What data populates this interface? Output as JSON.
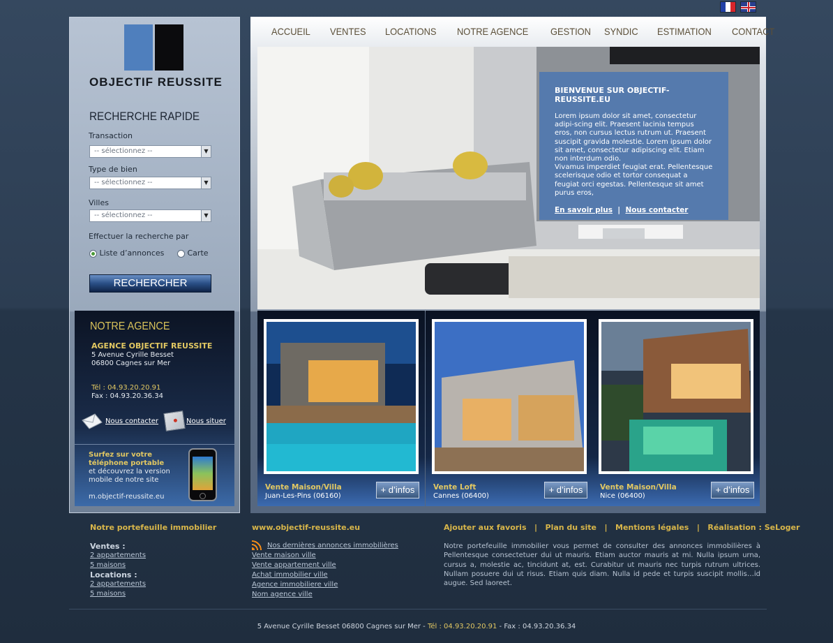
{
  "languages": [
    {
      "name": "Français",
      "icon": "flag-fr-icon"
    },
    {
      "name": "English",
      "icon": "flag-uk-icon"
    }
  ],
  "brand": {
    "name": "OBJECTIF REUSSITE",
    "colors": {
      "blue": "#4f7fbd",
      "black": "#0b0b0d"
    }
  },
  "nav": {
    "items": [
      "ACCUEIL",
      "VENTES",
      "LOCATIONS",
      "NOTRE AGENCE",
      "GESTION",
      "SYNDIC",
      "ESTIMATION",
      "CONTACT"
    ]
  },
  "search": {
    "title": "RECHERCHE RAPIDE",
    "transaction_label": "Transaction",
    "type_label": "Type de bien",
    "villes_label": "Villes",
    "select_value": "-- sélectionnez --",
    "mode_label": "Effectuer la recherche par",
    "mode_list": "Liste d’annonces",
    "mode_map": "Carte",
    "button": "RECHERCHER"
  },
  "welcome": {
    "title": "BIENVENUE SUR OBJECTIF-REUSSITE.EU",
    "text1": "Lorem ipsum dolor sit amet, consectetur adipi-scing elit. Praesent lacinia tempus eros, non cursus lectus rutrum ut. Praesent suscipit gravida molestie. Lorem ipsum dolor sit amet, consectetur adipiscing elit. Etiam non interdum odio.",
    "text2": "Vivamus imperdiet feugiat erat. Pellentesque scelerisque odio et tortor consequat a feugiat orci egestas. Pellentesque sit amet purus eros,",
    "link_more": "En savoir plus",
    "separator": "|",
    "link_contact": "Nous contacter"
  },
  "agence": {
    "title": "NOTRE AGENCE",
    "name": "AGENCE OBJECTIF REUSSITE",
    "address1": "5 Avenue Cyrille Besset",
    "address2": "06800 Cagnes sur Mer",
    "tel": "Tél : 04.93.20.20.91",
    "fax": "Fax : 04.93.20.36.34",
    "contact_link": "Nous contacter",
    "locate_link": "Nous situer",
    "mobile_title": "Surfez sur votre téléphone portable",
    "mobile_title1": "Surfez sur votre",
    "mobile_title2": "téléphone portable",
    "mobile_text1": "et découvrez la version",
    "mobile_text2": "mobile de notre site",
    "mobile_url": "m.objectif-reussite.eu"
  },
  "listings": [
    {
      "title": "Vente Maison/Villa",
      "location": "Juan-Les-Pins (06160)",
      "button": "+ d’infos"
    },
    {
      "title": "Vente Loft",
      "location": "Cannes (06400)",
      "button": "+ d’infos"
    },
    {
      "title": "Vente Maison/Villa",
      "location": "Nice (06400)",
      "button": "+ d’infos"
    }
  ],
  "footer": {
    "col1_title": "Notre portefeuille immobilier",
    "ventes_label": "Ventes :",
    "ventes_links": [
      "2 appartements",
      "5 maisons"
    ],
    "locations_label": "Locations :",
    "locations_links": [
      "2 appartements",
      "5 maisons"
    ],
    "col2_title": "www.objectif-reussite.eu",
    "rss_link": "Nos dernières annonces immobilières",
    "col2_links": [
      "Vente maison ville",
      "Vente appartement ville",
      "Achat immobilier ville",
      "Agence immobiliere ville",
      "Nom agence ville"
    ],
    "col3_links": [
      "Ajouter aux favoris",
      "Plan du site",
      "Mentions légales",
      "Réalisation : SeLoger"
    ],
    "col3_text": "Notre portefeuille immobilier vous permet de consulter des annonces immobilières à Pellentesque consectetuer dui ut mauris. Etiam auctor mauris at mi. Nulla ipsum urna, cursus a, molestie ac, tincidunt at, est. Curabitur ut mauris nec turpis rutrum ultrices. Nullam posuere dui ut risus. Etiam quis diam. Nulla id pede et turpis suscipit mollis…id augue. Sed laoreet.",
    "bottom_address": "5 Avenue Cyrille Besset 06800 Cagnes sur Mer",
    "bottom_tel": "Tél : 04.93.20.20.91",
    "bottom_fax": "Fax : 04.93.20.36.34"
  }
}
